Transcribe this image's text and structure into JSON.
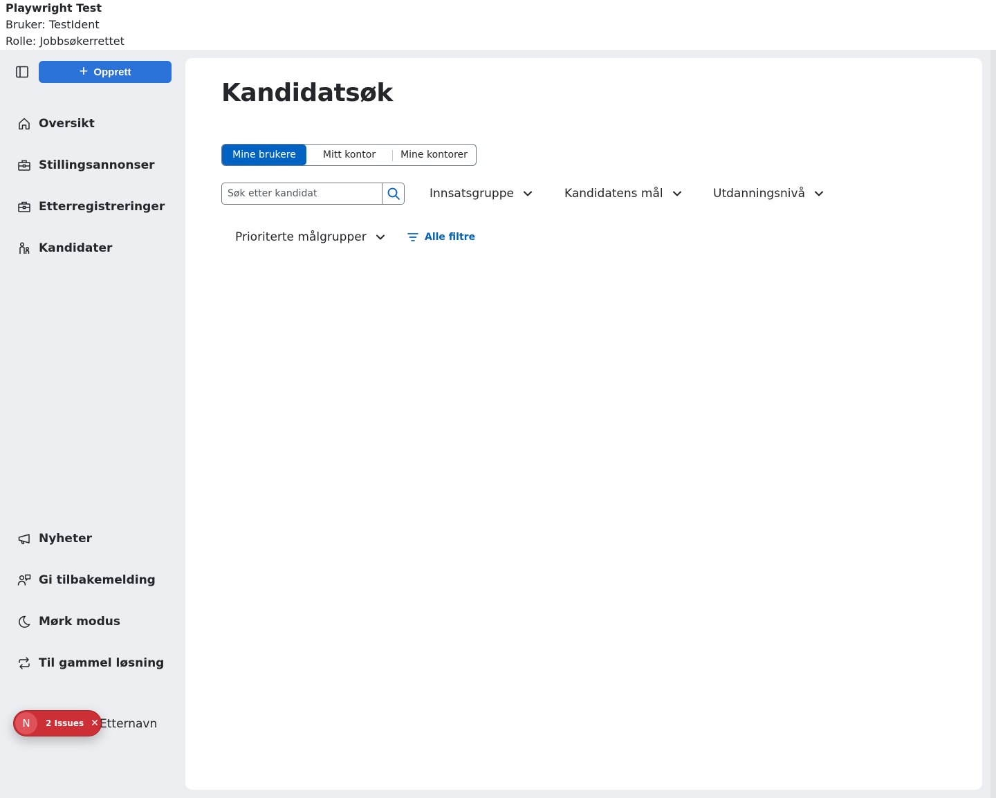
{
  "topinfo": {
    "title": "Playwright Test",
    "user_line": "Bruker: TestIdent",
    "role_line": "Rolle: Jobbsøkerrettet"
  },
  "sidebar": {
    "create_label": "Opprett",
    "nav_items": [
      {
        "label": "Oversikt",
        "icon": "home-icon"
      },
      {
        "label": "Stillingsannonser",
        "icon": "briefcase-icon"
      },
      {
        "label": "Etterregistreringer",
        "icon": "briefcase-icon"
      },
      {
        "label": "Kandidater",
        "icon": "people-icon"
      }
    ],
    "bottom_items": [
      {
        "label": "Nyheter",
        "icon": "megaphone-icon"
      },
      {
        "label": "Gi tilbakemelding",
        "icon": "person-chat-icon"
      },
      {
        "label": "Mørk modus",
        "icon": "moon-icon"
      },
      {
        "label": "Til gammel løsning",
        "icon": "arrows-swap-icon"
      }
    ],
    "user_name": "Etternavn",
    "issues_badge": {
      "letter": "N",
      "text": "2 Issues"
    }
  },
  "main": {
    "title": "Kandidatsøk",
    "toggle": {
      "options": [
        "Mine brukere",
        "Mitt kontor",
        "Mine kontorer"
      ],
      "selected": "Mine brukere"
    },
    "search": {
      "placeholder": "Søk etter kandidat",
      "value": ""
    },
    "filters": [
      "Innsatsgruppe",
      "Kandidatens mål",
      "Utdanningsnivå",
      "Prioriterte målgrupper"
    ],
    "all_filters_label": "Alle filtre"
  },
  "colors": {
    "primary": "#0063c1",
    "create_button": "#2a71d8",
    "sidebar_bg": "#eceef1",
    "issues_red": "#cc2f35"
  }
}
